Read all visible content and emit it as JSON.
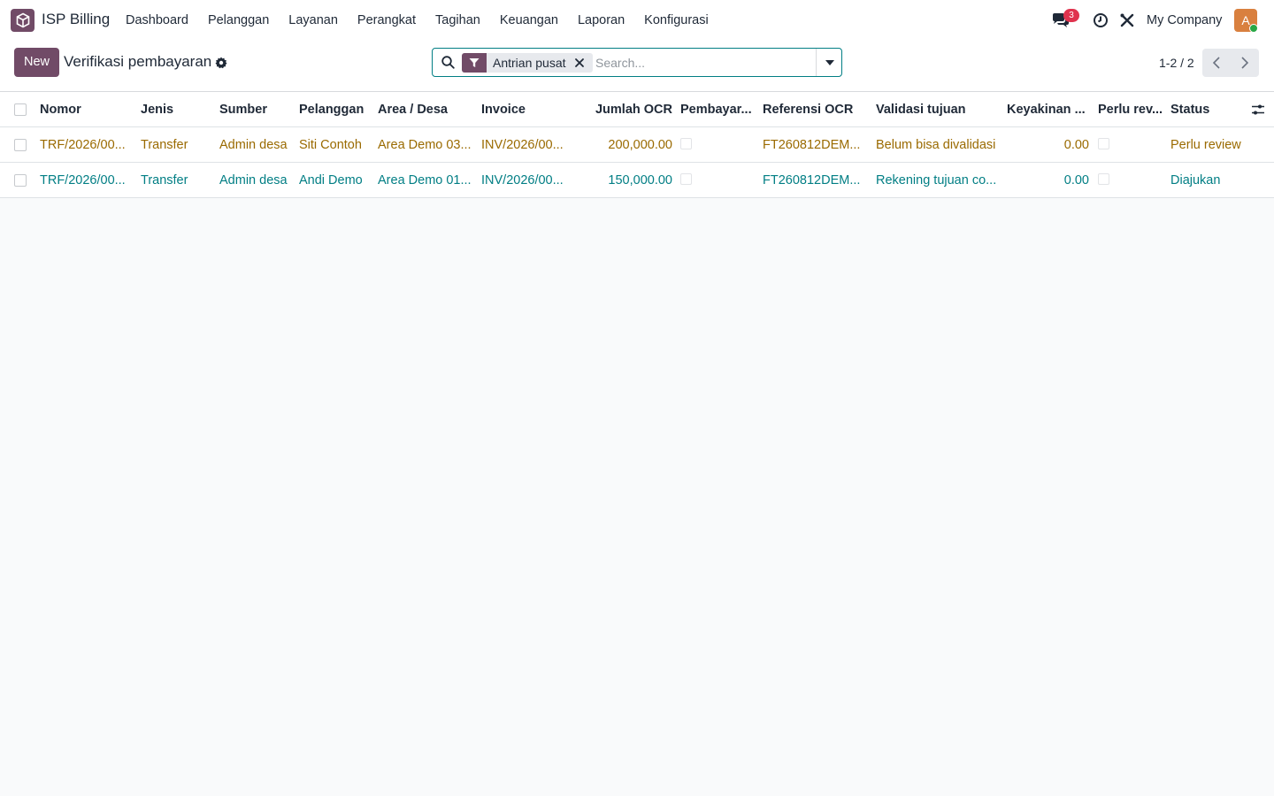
{
  "app": {
    "name": "ISP Billing"
  },
  "menu": [
    "Dashboard",
    "Pelanggan",
    "Layanan",
    "Perangkat",
    "Tagihan",
    "Keuangan",
    "Laporan",
    "Konfigurasi"
  ],
  "systray": {
    "messages_count": "3",
    "company": "My Company",
    "avatar_initial": "A"
  },
  "control": {
    "new_label": "New",
    "title": "Verifikasi pembayaran",
    "facet_label": "Antrian pusat",
    "search_placeholder": "Search...",
    "pager": "1-2 / 2"
  },
  "table": {
    "headers": [
      "Nomor",
      "Jenis",
      "Sumber",
      "Pelanggan",
      "Area / Desa",
      "Invoice",
      "Jumlah OCR",
      "Pembayar...",
      "Referensi OCR",
      "Validasi tujuan",
      "Keyakinan ...",
      "Perlu rev...",
      "Status"
    ],
    "rows": [
      {
        "nomor": "TRF/2026/00...",
        "jenis": "Transfer",
        "sumber": "Admin desa",
        "pelanggan": "Siti Contoh",
        "area": "Area Demo 03...",
        "invoice": "INV/2026/00...",
        "jumlah": "200,000.00",
        "referensi": "FT260812DEM...",
        "validasi": "Belum bisa divalidasi",
        "keyakinan": "0.00",
        "status": "Perlu review",
        "color": "#9a6a00"
      },
      {
        "nomor": "TRF/2026/00...",
        "jenis": "Transfer",
        "sumber": "Admin desa",
        "pelanggan": "Andi Demo",
        "area": "Area Demo 01...",
        "invoice": "INV/2026/00...",
        "jumlah": "150,000.00",
        "referensi": "FT260812DEM...",
        "validasi": "Rekening tujuan co...",
        "keyakinan": "0.00",
        "status": "Diajukan",
        "color": "#017e84"
      }
    ]
  },
  "colors": {
    "brand": "#714b67",
    "accent": "#017e84",
    "warning_row": "#9a6a00",
    "badge": "#e0334e"
  }
}
